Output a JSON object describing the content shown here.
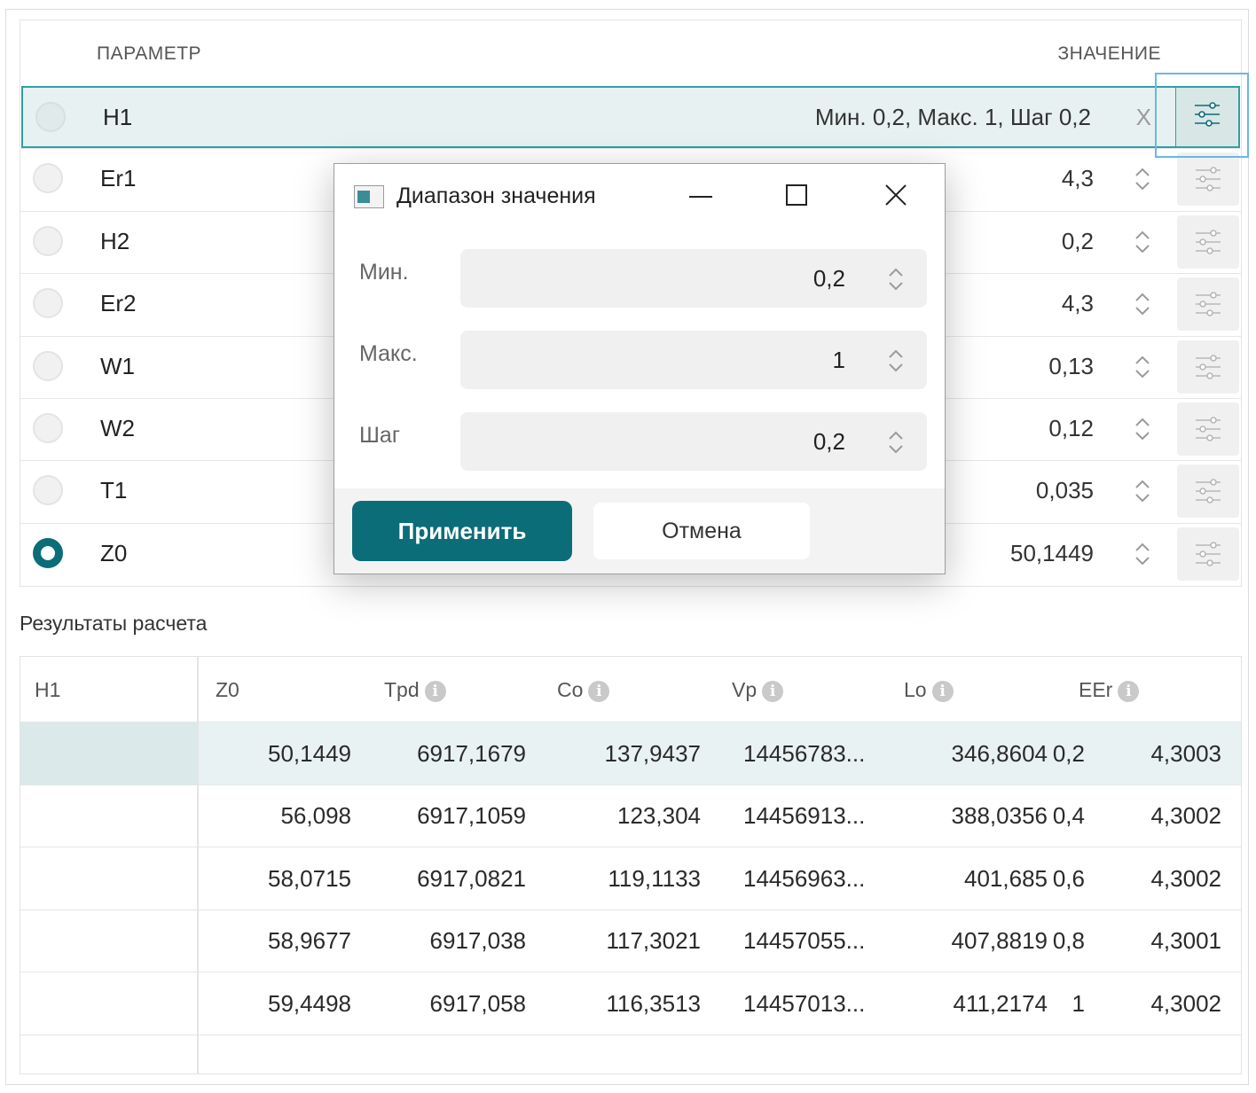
{
  "params": {
    "headers": {
      "param": "ПАРАМЕТР",
      "value": "ЗНАЧЕНИЕ"
    },
    "rows": [
      {
        "name": "H1",
        "value": "Мин. 0,2, Макс. 1, Шаг 0,2",
        "clear": "X",
        "selected": true,
        "radio": false
      },
      {
        "name": "Er1",
        "value": "4,3"
      },
      {
        "name": "H2",
        "value": "0,2"
      },
      {
        "name": "Er2",
        "value": "4,3"
      },
      {
        "name": "W1",
        "value": "0,13"
      },
      {
        "name": "W2",
        "value": "0,12"
      },
      {
        "name": "T1",
        "value": "0,035"
      },
      {
        "name": "Z0",
        "value": "50,1449",
        "radio": true
      }
    ]
  },
  "results": {
    "title": "Результаты расчета",
    "columns": [
      "H1",
      "Z0",
      "Tpd",
      "Co",
      "Vp",
      "Lo",
      "EEr"
    ],
    "info_columns": [
      false,
      false,
      true,
      true,
      true,
      true,
      true
    ],
    "rows": [
      [
        "0,2",
        "50,1449",
        "6917,1679",
        "137,9437",
        "14456783...",
        "346,8604",
        "4,3003"
      ],
      [
        "0,4",
        "56,098",
        "6917,1059",
        "123,304",
        "14456913...",
        "388,0356",
        "4,3002"
      ],
      [
        "0,6",
        "58,0715",
        "6917,0821",
        "119,1133",
        "14456963...",
        "401,685",
        "4,3002"
      ],
      [
        "0,8",
        "58,9677",
        "6917,038",
        "117,3021",
        "14457055...",
        "407,8819",
        "4,3001"
      ],
      [
        "1",
        "59,4498",
        "6917,058",
        "116,3513",
        "14457013...",
        "411,2174",
        "4,3002"
      ]
    ]
  },
  "dialog": {
    "title": "Диапазон значения",
    "fields": [
      {
        "label": "Мин.",
        "value": "0,2"
      },
      {
        "label": "Макс.",
        "value": "1"
      },
      {
        "label": "Шаг",
        "value": "0,2"
      }
    ],
    "apply_label": "Применить",
    "cancel_label": "Отмена"
  },
  "colors": {
    "accent": "#0b6d78",
    "selection": "#e8f1f1",
    "focus": "#6bb6e8"
  }
}
